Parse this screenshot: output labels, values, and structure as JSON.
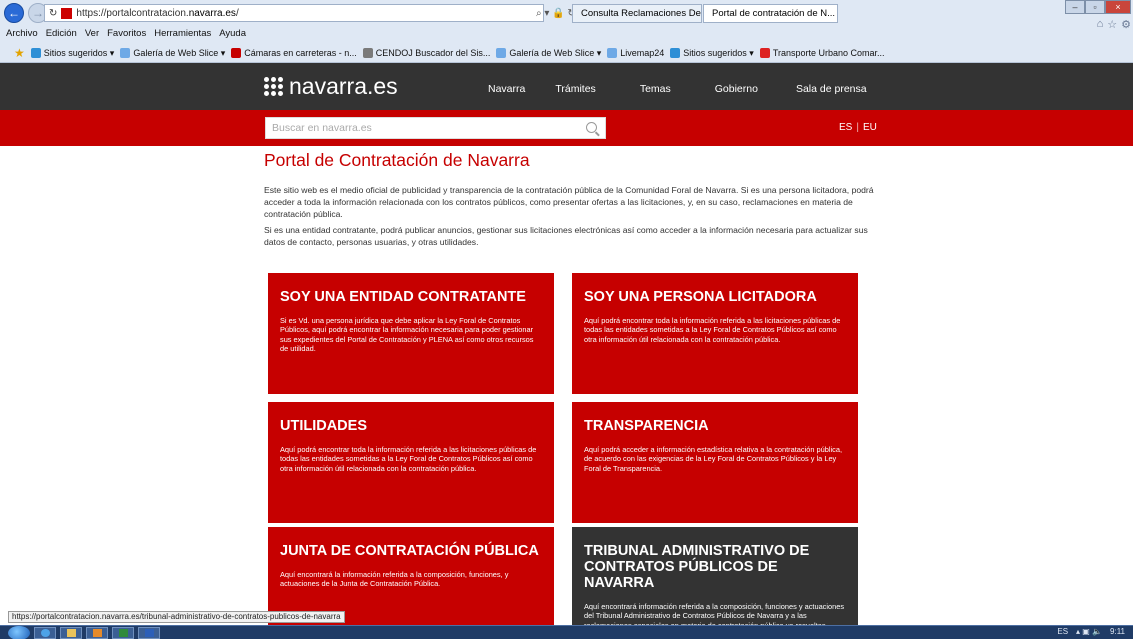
{
  "browser": {
    "url_prefix": "https://portalcontratacion.",
    "url_domain": "navarra.es",
    "url_suffix": "/",
    "addr_tools": "⌕ ▾ 🔒 ↻",
    "tabs": [
      {
        "label": "Consulta Reclamaciones Detalle",
        "color": "#2e8fd6"
      },
      {
        "label": "Portal de contratación de N...",
        "color": "#c60000"
      }
    ],
    "menu": [
      "Archivo",
      "Edición",
      "Ver",
      "Favoritos",
      "Herramientas",
      "Ayuda"
    ],
    "favorites": [
      {
        "label": "Sitios sugeridos ▾",
        "color": "#2e8fd6"
      },
      {
        "label": "Galería de Web Slice ▾",
        "color": "#6ea9e6"
      },
      {
        "label": "Cámaras en carreteras - n...",
        "color": "#c60000"
      },
      {
        "label": "CENDOJ Buscador del Sis...",
        "color": "#7a7a7a"
      },
      {
        "label": "Galería de Web Slice ▾",
        "color": "#6ea9e6"
      },
      {
        "label": "Livemap24",
        "color": "#6ea9e6"
      },
      {
        "label": "Sitios sugeridos ▾",
        "color": "#2e8fd6"
      },
      {
        "label": "Transporte Urbano Comar...",
        "color": "#d22"
      }
    ],
    "status_url": "https://portalcontratacion.navarra.es/tribunal-administrativo-de-contratos-publicos-de-navarra"
  },
  "header": {
    "logo_text": "navarra.es",
    "nav": [
      "Navarra",
      "Trámites",
      "Temas",
      "Gobierno",
      "Sala de prensa"
    ],
    "search_placeholder": "Buscar en navarra.es",
    "lang_es": "ES",
    "lang_sep": "|",
    "lang_eu": "EU"
  },
  "main": {
    "title": "Portal de Contratación de Navarra",
    "intro_1": "Este sitio web es el medio oficial de publicidad y transparencia de la contratación pública de la Comunidad Foral de Navarra. Si es una persona licitadora, podrá acceder a toda la información relacionada con los contratos públicos, como presentar ofertas a las licitaciones, y, en su caso, reclamaciones en materia de contratación pública.",
    "intro_2": "Si es una entidad contratante, podrá publicar anuncios, gestionar sus licitaciones electrónicas así como acceder a la información necesaria para actualizar sus datos de contacto, personas usuarias, y otras utilidades.",
    "cards": [
      {
        "title": "SOY UNA ENTIDAD CONTRATANTE",
        "text": "Si es Vd. una persona jurídica que debe aplicar la Ley Foral de Contratos Públicos, aquí podrá encontrar la información necesaria para poder gestionar sus expedientes del Portal de Contratación y PLENA así como otros recursos de utilidad."
      },
      {
        "title": "SOY UNA PERSONA LICITADORA",
        "text": "Aquí podrá encontrar toda la información referida a las licitaciones públicas de todas las entidades sometidas a la Ley Foral de Contratos Públicos así como otra información útil relacionada con la contratación pública."
      },
      {
        "title": "UTILIDADES",
        "text": "Aquí podrá encontrar toda la información referida a las licitaciones públicas de todas las entidades sometidas a la Ley Foral de Contratos Públicos así como otra información útil relacionada con la contratación pública."
      },
      {
        "title": "TRANSPARENCIA",
        "text": "Aquí podrá acceder a información estadística relativa a la contratación pública, de acuerdo con las exigencias de la Ley Foral de Contratos Públicos y la Ley Foral de Transparencia."
      },
      {
        "title": "JUNTA DE CONTRATACIÓN PÚBLICA",
        "text": "Aquí encontrará la información referida a la composición, funciones, y actuaciones de la Junta de Contratación Pública."
      },
      {
        "title": "TRIBUNAL ADMINISTRATIVO DE CONTRATOS PÚBLICOS DE NAVARRA",
        "text": "Aquí encontrará información referida a la composición, funciones y actuaciones del Tribunal Administrativo de Contratos Públicos de Navarra y a las reclamaciones especiales en materia de contratación pública ya resueltas."
      }
    ]
  },
  "taskbar": {
    "tray_lang": "ES",
    "tray_icons": "▴ ▣ 🔈",
    "clock": "9:11"
  }
}
